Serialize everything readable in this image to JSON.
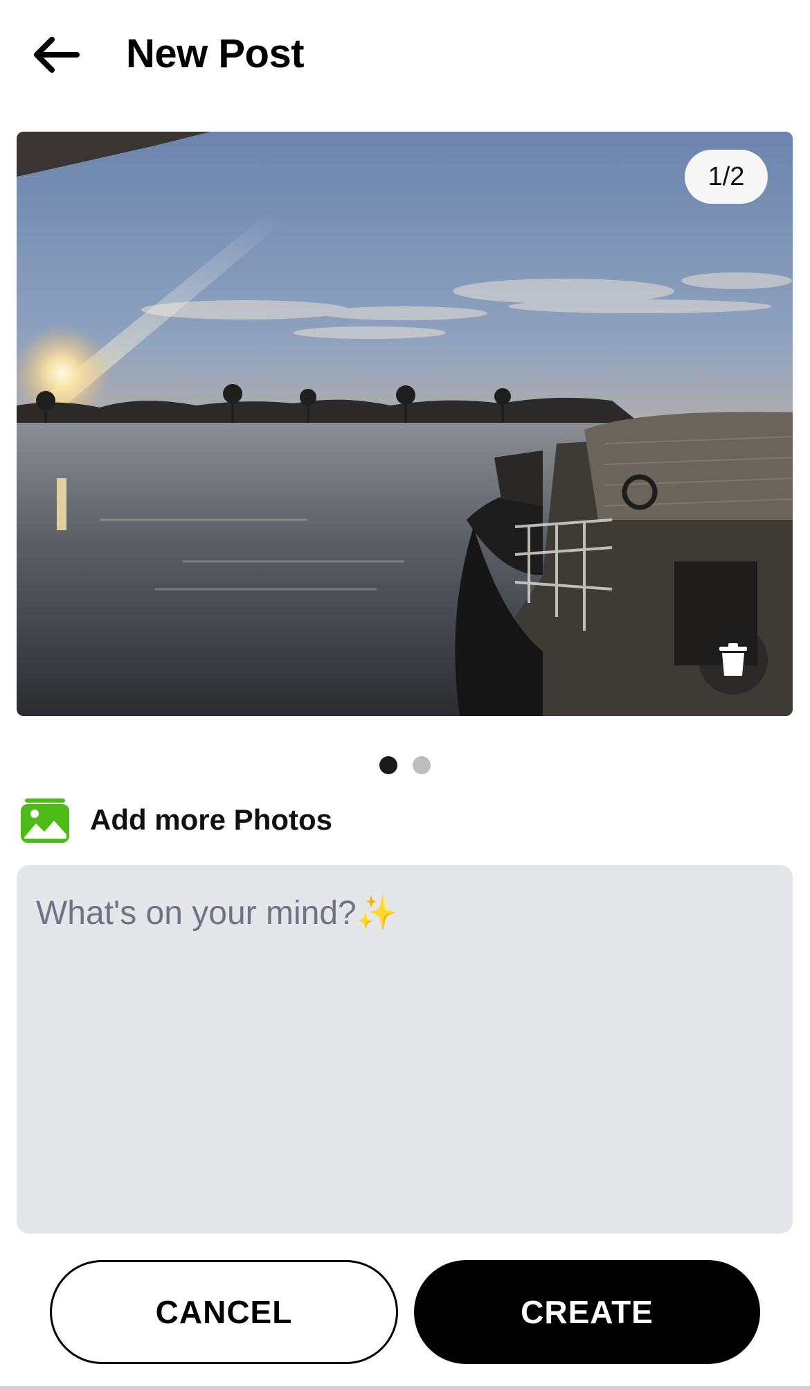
{
  "header": {
    "title": "New Post",
    "back_icon": "arrow-left-icon"
  },
  "photo_viewer": {
    "counter": "1/2",
    "current": 1,
    "total": 2,
    "delete_icon": "trash-icon"
  },
  "pager": {
    "dots": 2,
    "active_index": 0
  },
  "add_photos": {
    "label": "Add more Photos",
    "icon": "photo-gallery-icon",
    "icon_color": "#4cbb17"
  },
  "composer": {
    "placeholder": "What's on your mind?✨",
    "value": ""
  },
  "actions": {
    "cancel_label": "CANCEL",
    "create_label": "CREATE"
  }
}
